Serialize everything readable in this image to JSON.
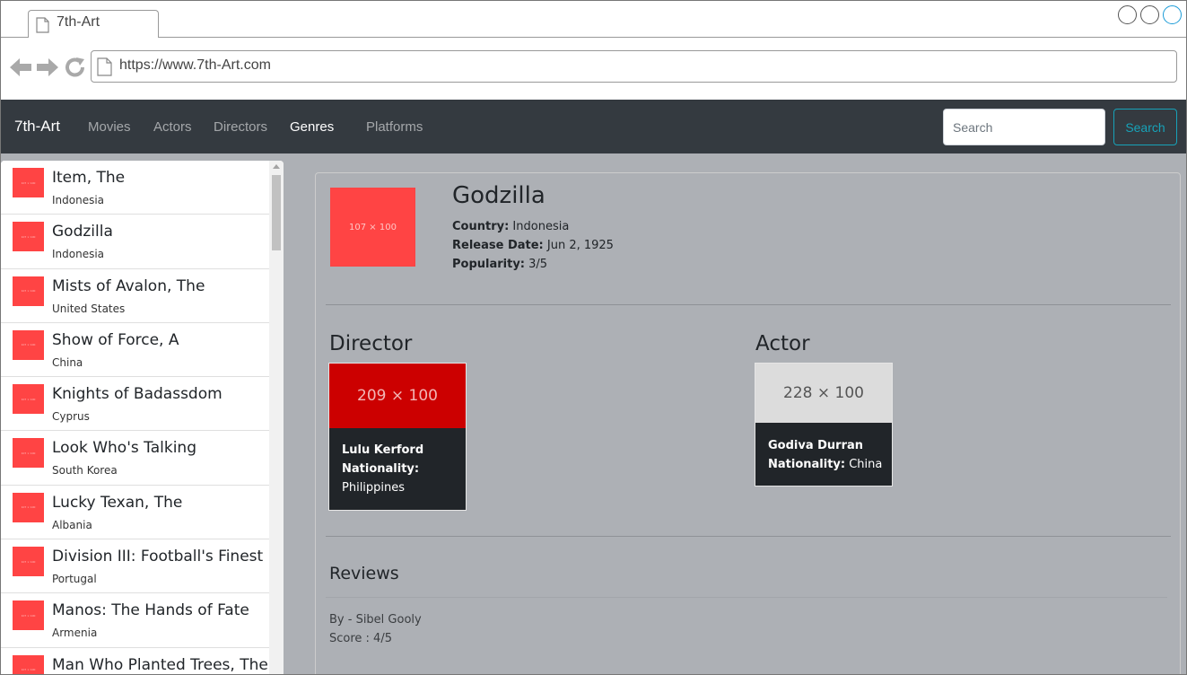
{
  "browser": {
    "tab_title": "7th-Art",
    "url": "https://www.7th-Art.com"
  },
  "navbar": {
    "brand": "7th-Art",
    "links": [
      "Movies",
      "Actors",
      "Directors",
      "Genres",
      "Platforms"
    ],
    "active_link": "Genres",
    "search_placeholder": "Search",
    "search_button": "Search"
  },
  "sidebar": {
    "thumb_label": "107 × 100",
    "movies": [
      {
        "title": "Item, The",
        "country": "Indonesia"
      },
      {
        "title": "Godzilla",
        "country": "Indonesia"
      },
      {
        "title": "Mists of Avalon, The",
        "country": "United States"
      },
      {
        "title": "Show of Force, A",
        "country": "China"
      },
      {
        "title": "Knights of Badassdom",
        "country": "Cyprus"
      },
      {
        "title": "Look Who's Talking",
        "country": "South Korea"
      },
      {
        "title": "Lucky Texan, The",
        "country": "Albania"
      },
      {
        "title": "Division III: Football's Finest",
        "country": "Portugal"
      },
      {
        "title": "Manos: The Hands of Fate",
        "country": "Armenia"
      },
      {
        "title": "Man Who Planted Trees, The",
        "country": ""
      }
    ]
  },
  "detail": {
    "poster_label": "107 × 100",
    "title": "Godzilla",
    "country_label": "Country:",
    "country": "Indonesia",
    "release_label": "Release Date:",
    "release_date": "Jun 2, 1925",
    "popularity_label": "Popularity:",
    "popularity": "3/5",
    "director": {
      "heading": "Director",
      "image_label": "209 × 100",
      "name": "Lulu Kerford",
      "nationality_label": "Nationality:",
      "nationality": "Philippines"
    },
    "actor": {
      "heading": "Actor",
      "image_label": "228 × 100",
      "name": "Godiva Durran",
      "nationality_label": "Nationality:",
      "nationality": "China"
    },
    "reviews": {
      "heading": "Reviews",
      "by": "By - Sibel Gooly",
      "score": "Score : 4/5"
    }
  },
  "colors": {
    "navbar_bg": "#343a40",
    "content_bg": "#adb0b5",
    "placeholder_red": "#ff4444",
    "director_img_red": "#cc0000",
    "search_accent": "#17a2b8"
  }
}
